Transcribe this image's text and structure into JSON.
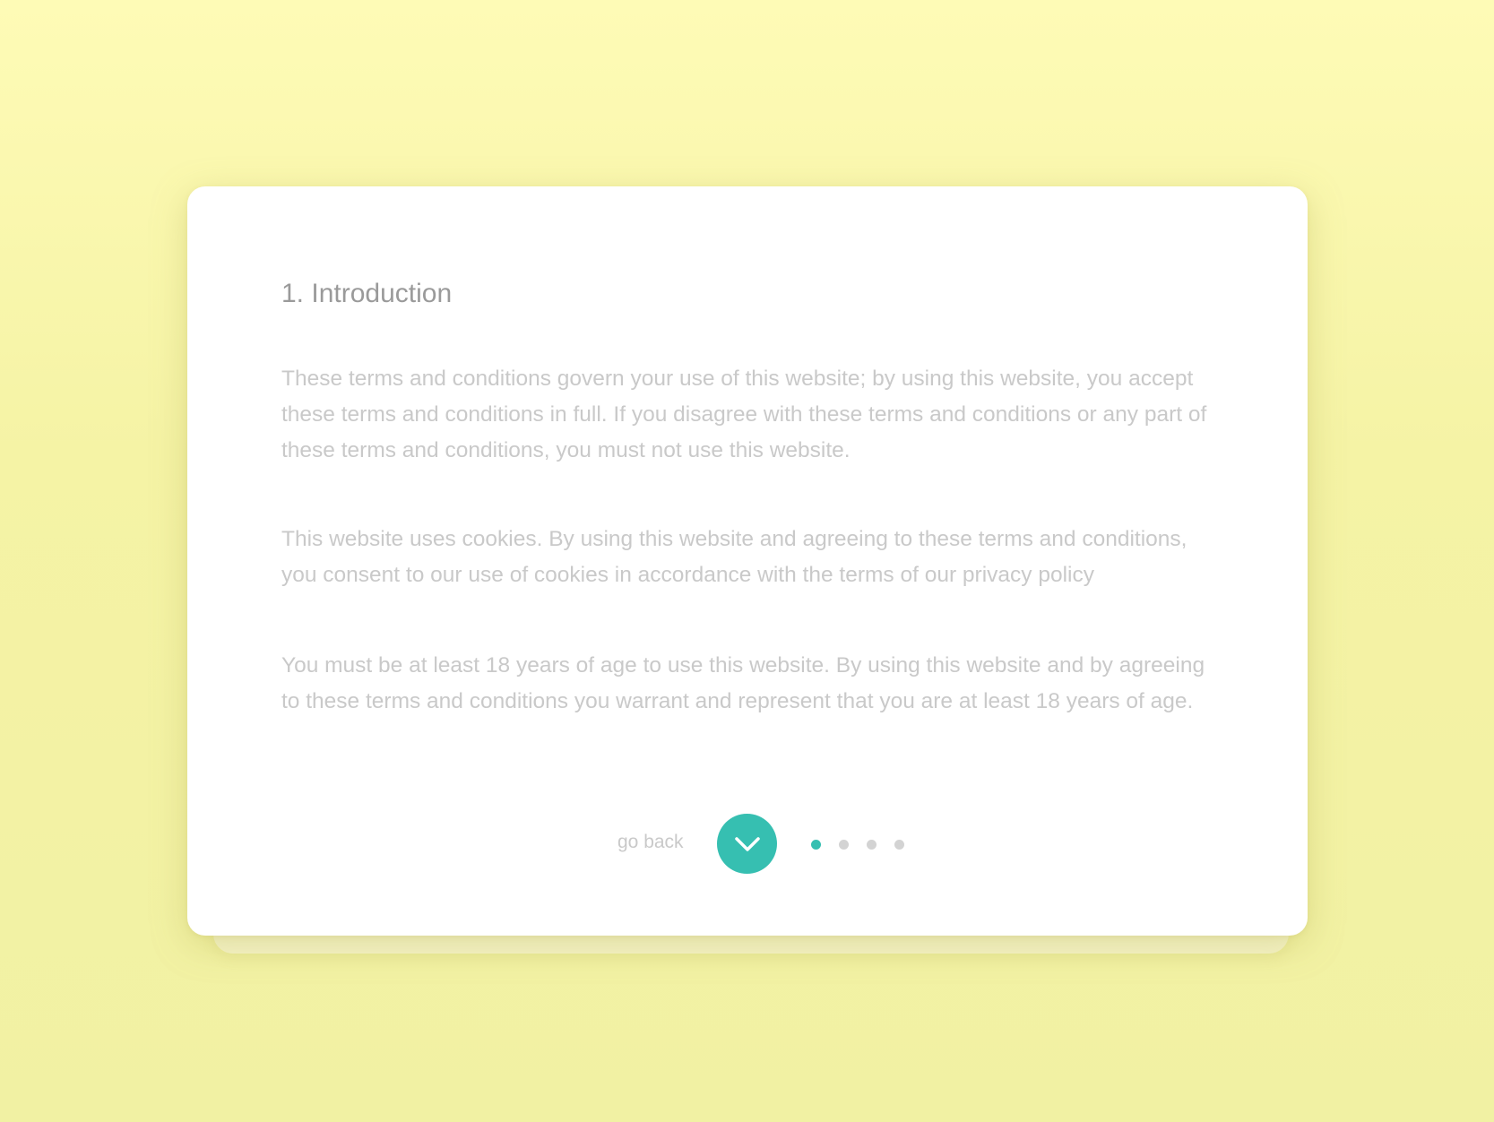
{
  "colors": {
    "background": "#f5f3a5",
    "card": "#ffffff",
    "accent": "#36bfb1",
    "title_text": "#9a9a9a",
    "body_text": "#c9c9c9",
    "inactive_dot": "#d3d3d3"
  },
  "section": {
    "title": "1. Introduction",
    "paragraphs": [
      "These terms and conditions govern your use of this website; by using this website, you accept these terms and conditions in full.   If you disagree with these terms and conditions or any part of these terms and conditions, you must not use this website.",
      "This website uses cookies.  By using this website and agreeing to these terms and conditions, you consent to our use of cookies in accordance with the terms of our privacy policy",
      "You must be at least 18 years of age to use this website.  By using this website and by agreeing to these terms and conditions you warrant and represent that you are at least 18 years of age."
    ]
  },
  "navigation": {
    "back_label": "go back",
    "next_icon": "chevron-down-icon",
    "pages_total": 4,
    "current_page": 1
  }
}
